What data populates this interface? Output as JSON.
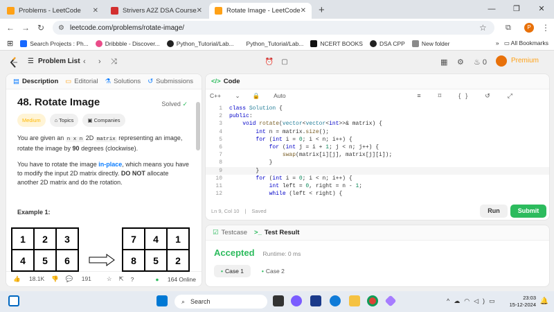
{
  "browser": {
    "tabs": [
      {
        "title": "Problems - LeetCode",
        "fav": "#ffa116",
        "active": false
      },
      {
        "title": "Strivers A2Z DSA Course/Sheet",
        "fav": "#d32f2f",
        "active": false
      },
      {
        "title": "Rotate Image - LeetCode",
        "fav": "#ffa116",
        "active": true
      }
    ],
    "url": "leetcode.com/problems/rotate-image/",
    "bookmarks": [
      "Search Projects : Ph...",
      "Dribbble - Discover...",
      "Python_Tutorial/Lab...",
      "Python_Tutorial/Lab...",
      "NCERT BOOKS",
      "DSA CPP",
      "New folder"
    ],
    "all_bookmarks": "All Bookmarks",
    "profile": "P"
  },
  "header": {
    "problem_list": "Problem List",
    "fire_count": "0",
    "premium": "Premium"
  },
  "left": {
    "tabs": [
      "Description",
      "Editorial",
      "Solutions",
      "Submissions"
    ],
    "title": "48. Rotate Image",
    "solved": "Solved",
    "tags": [
      "Medium",
      "Topics",
      "Companies"
    ],
    "p1_a": "You are given an ",
    "p1_code": "n x n",
    "p1_b": " 2D ",
    "p1_code2": "matrix",
    "p1_c": " representing an image, rotate the image by ",
    "p1_bold": "90",
    "p1_d": " degrees (clockwise).",
    "p2_a": "You have to rotate the image ",
    "p2_link": "in-place",
    "p2_b": ", which means you have to modify the input 2D matrix directly. ",
    "p2_bold": "DO NOT",
    "p2_c": " allocate another 2D matrix and do the rotation.",
    "example": "Example 1:",
    "grid_before": [
      "1",
      "2",
      "3",
      "4",
      "5",
      "6"
    ],
    "grid_after": [
      "7",
      "4",
      "1",
      "8",
      "5",
      "2"
    ],
    "likes": "18.1K",
    "comments": "191",
    "online": "164 Online"
  },
  "editor": {
    "title": "Code",
    "lang": "C++",
    "mode": "Auto",
    "lines": [
      "class Solution {",
      "public:",
      "    void rotate(vector<vector<int>>& matrix) {",
      "        int n = matrix.size();",
      "        for (int i = 0; i < n; i++) {",
      "            for (int j = i + 1; j < n; j++) {",
      "                swap(matrix[i][j], matrix[j][i]);",
      "            }",
      "        }",
      "        for (int i = 0; i < n; i++) {",
      "            int left = 0, right = n - 1;",
      "            while (left < right) {"
    ],
    "status": "Ln 9, Col 10",
    "saved": "Saved",
    "run": "Run",
    "submit": "Submit"
  },
  "result": {
    "tabs": [
      "Testcase",
      "Test Result"
    ],
    "status": "Accepted",
    "runtime": "Runtime: 0 ms",
    "cases": [
      "Case 1",
      "Case 2"
    ]
  },
  "taskbar": {
    "search": "Search",
    "time": "23:03",
    "date": "15-12-2024"
  }
}
